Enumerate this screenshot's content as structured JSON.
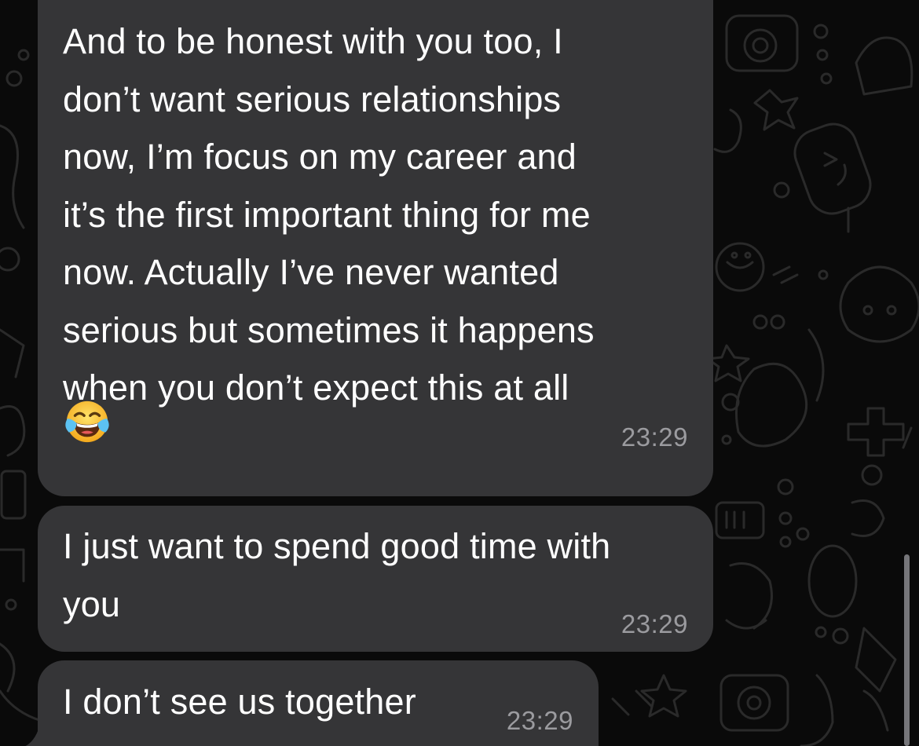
{
  "messages": [
    {
      "text": "And to be honest with you too, I\ndon’t want serious relationships\nnow, I’m focus on my career and\nit’s the first important thing for me\nnow. Actually I’ve never wanted\nserious but sometimes it happens\nwhen you don’t expect this at all",
      "emoji": "face-with-tears-of-joy",
      "time": "23:29"
    },
    {
      "text": "I just want to spend good time with\nyou",
      "time": "23:29"
    },
    {
      "text": "I don’t see us together",
      "time": "23:29"
    }
  ],
  "theme": {
    "bubble_color": "#353537",
    "background_color": "#0a0a0a",
    "text_color": "#ffffff",
    "time_color": "#9b9b9f"
  }
}
